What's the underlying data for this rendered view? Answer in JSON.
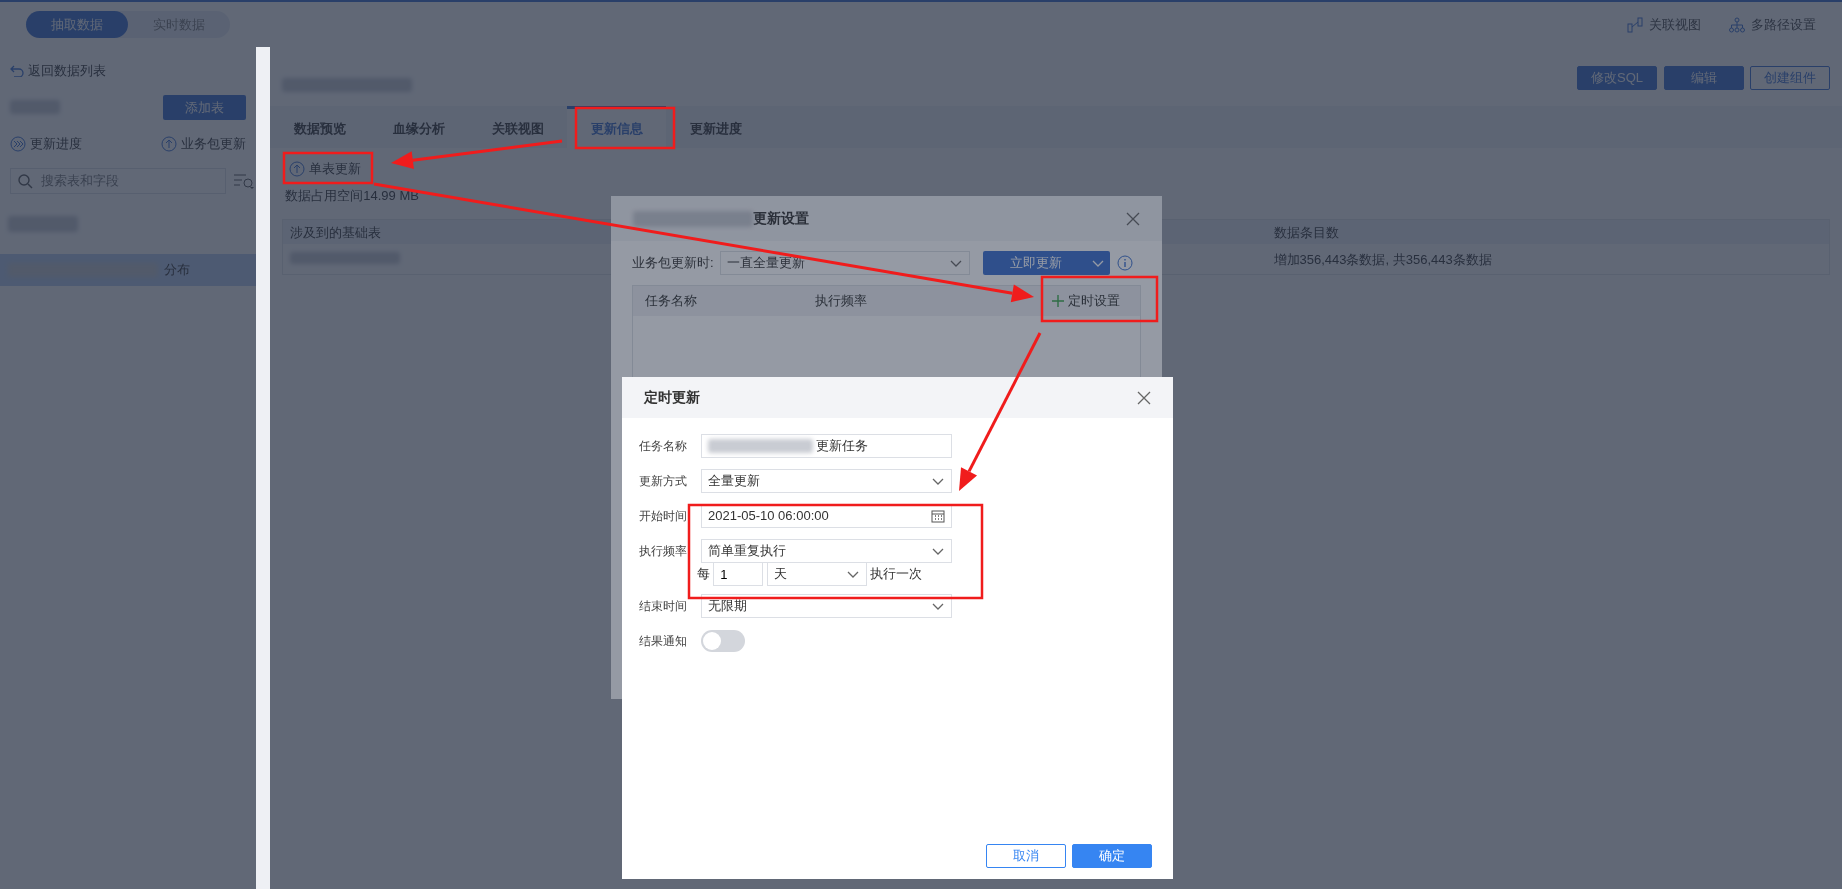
{
  "top_bar": {
    "mode_tabs": [
      {
        "label": "抽取数据",
        "selected": true
      },
      {
        "label": "实时数据",
        "selected": false
      }
    ],
    "actions": [
      {
        "kind": "relation",
        "label": "关联视图"
      },
      {
        "kind": "paths",
        "label": "多路径设置"
      }
    ]
  },
  "sidebar": {
    "back": "返回数据列表",
    "add_button": "添加表",
    "links": [
      {
        "kind": "progress",
        "label": "更新进度"
      },
      {
        "kind": "upload",
        "label": "业务包更新"
      }
    ],
    "search": {
      "placeholder": "搜索表和字段"
    },
    "items": [
      {
        "kind": "blurred",
        "selected": false
      },
      {
        "kind": "table",
        "label": "分布",
        "selected": true
      }
    ]
  },
  "main": {
    "buttons": [
      {
        "kind": "primary",
        "label": "修改SQL"
      },
      {
        "kind": "primary",
        "label": "编辑"
      },
      {
        "kind": "outline",
        "label": "创建组件"
      }
    ],
    "tabs": [
      {
        "label": "数据预览",
        "selected": false
      },
      {
        "label": "血缘分析",
        "selected": false
      },
      {
        "label": "关联视图",
        "selected": false
      },
      {
        "label": "更新信息",
        "selected": true
      },
      {
        "label": "更新进度",
        "selected": false
      }
    ],
    "single_update": "单表更新",
    "storage": "数据占用空间14.99 MB",
    "table": {
      "columns": [
        "涉及到的基础表",
        "数据条目数"
      ],
      "rows": [
        {
          "data_count": "增加356,443条数据, 共356,443条数据"
        }
      ]
    }
  },
  "update_dialog": {
    "title": "更新设置",
    "update_label": "业务包更新时:",
    "update_mode": "一直全量更新",
    "update_now": "立即更新",
    "task_columns": [
      "任务名称",
      "执行频率"
    ],
    "schedule_button": "定时设置"
  },
  "schedule_dialog": {
    "title": "定时更新",
    "fields": [
      {
        "kind": "text",
        "label": "任务名称",
        "value": "更新任务"
      },
      {
        "kind": "select",
        "label": "更新方式",
        "value": "全量更新"
      },
      {
        "kind": "date",
        "label": "开始时间",
        "value": "2021-05-10 06:00:00"
      },
      {
        "kind": "select",
        "label": "执行频率",
        "value": "简单重复执行"
      },
      {
        "kind": "repeat",
        "prefix": "每",
        "count": "1",
        "unit": "天",
        "suffix": "执行一次"
      },
      {
        "kind": "select",
        "label": "结束时间",
        "value": "无限期"
      },
      {
        "kind": "switch",
        "label": "结果通知",
        "on": false
      }
    ],
    "buttons": [
      {
        "kind": "cancel",
        "label": "取消"
      },
      {
        "kind": "confirm",
        "label": "确定"
      }
    ]
  }
}
